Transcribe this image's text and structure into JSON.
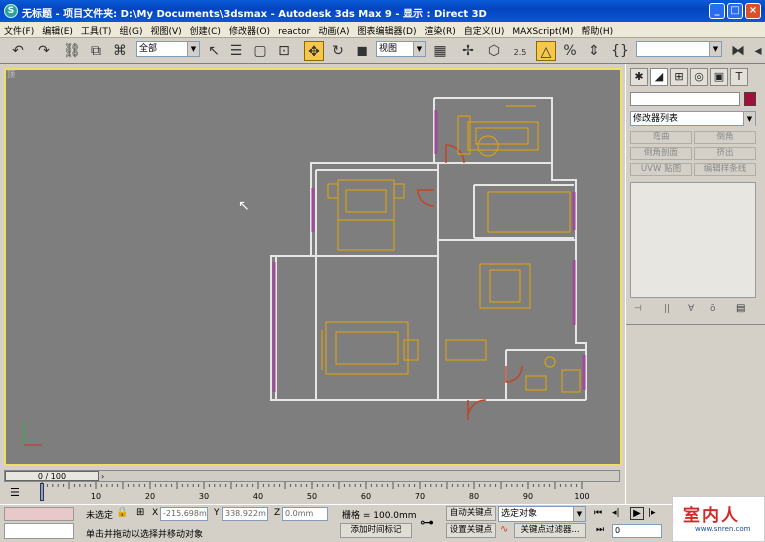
{
  "window": {
    "title": "无标题   - 项目文件夹: D:\\My Documents\\3dsmax    - Autodesk 3ds Max 9     - 显示 : Direct 3D"
  },
  "menu": [
    "文件(F)",
    "编辑(E)",
    "工具(T)",
    "组(G)",
    "视图(V)",
    "创建(C)",
    "修改器(O)",
    "reactor",
    "动画(A)",
    "图表编辑器(D)",
    "渲染(R)",
    "自定义(U)",
    "MAXScript(M)",
    "帮助(H)"
  ],
  "toolbar": {
    "selection_filter": "全部",
    "reference_coord": "视图",
    "snap_angle": "2.5"
  },
  "viewport": {
    "label": "顶"
  },
  "command_panel": {
    "modifier_list": "修改器列表",
    "buttons": [
      "弯曲",
      "倒角",
      "倒角剖面",
      "挤出",
      "UVW 贴图",
      "编辑样条线"
    ]
  },
  "timeline": {
    "frame_counter": "0 / 100",
    "ticks": [
      "0",
      "10",
      "20",
      "30",
      "40",
      "50",
      "60",
      "70",
      "80",
      "90",
      "100"
    ]
  },
  "status": {
    "selection": "未选定",
    "x_label": "X",
    "x_value": "-215.698m",
    "y_label": "Y",
    "y_value": "338.922m",
    "z_label": "Z",
    "z_value": "0.0mm",
    "grid": "栅格 = 100.0mm",
    "auto_key": "自动关键点",
    "set_key": "设置关键点",
    "selected_object": "选定对象",
    "key_filters": "关键点过滤器...",
    "prompt": "单击并拖动以选择并移动对象",
    "add_time_tag": "添加时间标记",
    "frame_value": "0"
  },
  "watermark": {
    "brand": "室内人",
    "site": "www.snren.com"
  },
  "colors": {
    "viewport_bg": "#7e7e7e",
    "wall": "#e6e6e6",
    "furniture": "#d4a017",
    "window": "#a04a9a",
    "door": "#c0442a"
  }
}
